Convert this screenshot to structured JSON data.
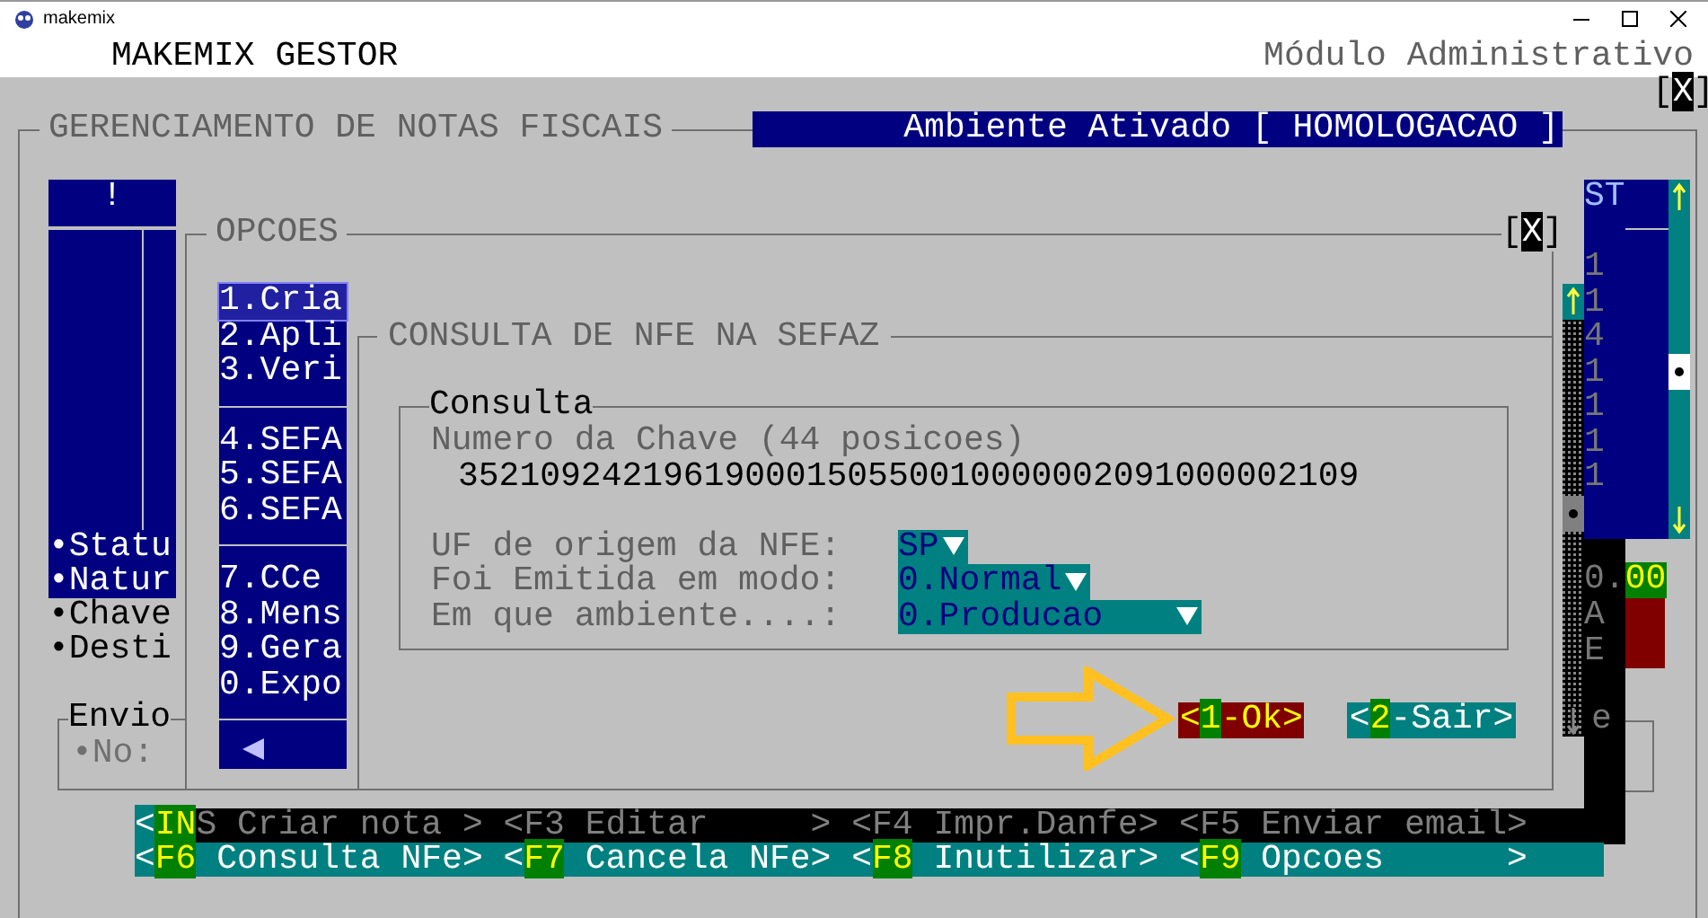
{
  "window": {
    "title": "makemix"
  },
  "header": {
    "app_name": "MAKEMIX GESTOR",
    "module": "Módulo Administrativo"
  },
  "top_close": {
    "open": "[",
    "label": "X",
    "close": "]"
  },
  "main_panel": {
    "title": "GERENCIAMENTO DE NOTAS FISCAIS",
    "environment": "Ambiente Ativado [ HOMOLOGACAO ]"
  },
  "left_list": {
    "header": "!",
    "items": [
      {
        "label": "•Statu",
        "selected": true
      },
      {
        "label": "•Natur",
        "selected": true
      },
      {
        "label": "•Chave",
        "selected": false
      },
      {
        "label": "•Desti",
        "selected": false
      }
    ]
  },
  "envio": {
    "title": "Envio",
    "field": "•No:"
  },
  "options_window": {
    "title": "OPCOES",
    "close": {
      "open": "[",
      "label": "X",
      "close": "]"
    },
    "groups": [
      [
        {
          "label": "1.Cria",
          "selected": true
        },
        {
          "label": "2.Apli",
          "selected": false
        },
        {
          "label": "3.Veri",
          "selected": false
        }
      ],
      [
        {
          "label": "4.SEFA",
          "selected": false
        },
        {
          "label": "5.SEFA",
          "selected": false
        },
        {
          "label": "6.SEFA",
          "selected": false
        }
      ],
      [
        {
          "label": "7.CCe",
          "selected": false
        },
        {
          "label": "8.Mens",
          "selected": false
        },
        {
          "label": "9.Gera",
          "selected": false
        },
        {
          "label": "0.Expo",
          "selected": false
        }
      ]
    ]
  },
  "consulta_window": {
    "title": "CONSULTA DE NFE NA SEFAZ",
    "group_title": "Consulta",
    "key_label": "Numero da Chave (44 posicoes)",
    "key_value": "35210924219619000150550010000002091000002109",
    "fields": [
      {
        "label": "UF de origem da NFE:",
        "value": "SP"
      },
      {
        "label": "Foi Emitida em modo:",
        "value": "0.Normal"
      },
      {
        "label": "Em que ambiente....:",
        "value": "0.Producao"
      }
    ],
    "buttons": [
      {
        "open": "<",
        "key": "1",
        "label": "-Ok>",
        "selected": true
      },
      {
        "open": "<",
        "key": "2",
        "label": "-Sair>",
        "selected": false
      }
    ]
  },
  "status_column": {
    "header": "ST",
    "values": [
      "1",
      "1",
      "4",
      "1",
      "1",
      "1",
      "1"
    ],
    "total_prefix": "0.",
    "total_highlight": "00",
    "letters": [
      "A",
      "E"
    ],
    "partial": "e"
  },
  "shortcuts": [
    {
      "active": false,
      "items": [
        {
          "open": "<",
          "key": "IN",
          "label": "S Criar nota >",
          "key_highlighted": true
        },
        {
          "open": "<",
          "key": "F3",
          "label": " Editar     >",
          "key_highlighted": false
        },
        {
          "open": "<",
          "key": "F4",
          "label": " Impr.Danfe>",
          "key_highlighted": false
        },
        {
          "open": "<",
          "key": "F5",
          "label": " Enviar email>",
          "key_highlighted": false
        }
      ]
    },
    {
      "active": true,
      "items": [
        {
          "open": "<",
          "key": "F6",
          "label": " Consulta NFe>",
          "key_highlighted": true
        },
        {
          "open": "<",
          "key": "F7",
          "label": " Cancela NFe>",
          "key_highlighted": true
        },
        {
          "open": "<",
          "key": "F8",
          "label": " Inutilizar>",
          "key_highlighted": true
        },
        {
          "open": "<",
          "key": "F9",
          "label": " Opcoes      >",
          "key_highlighted": true
        }
      ]
    }
  ]
}
